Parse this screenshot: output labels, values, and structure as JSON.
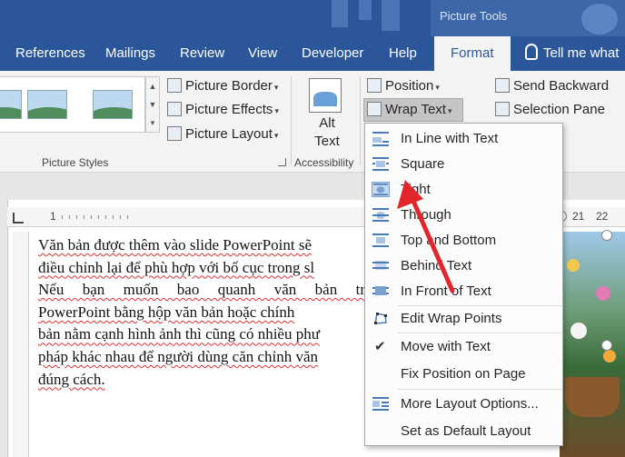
{
  "context_tab": {
    "label": "Picture Tools"
  },
  "tabs": [
    {
      "label": "References"
    },
    {
      "label": "Mailings"
    },
    {
      "label": "Review"
    },
    {
      "label": "View"
    },
    {
      "label": "Developer"
    },
    {
      "label": "Help"
    },
    {
      "label": "Format"
    }
  ],
  "tell_me": {
    "label": "Tell me what"
  },
  "ribbon": {
    "picture_border": "Picture Border",
    "picture_effects": "Picture Effects",
    "picture_layout": "Picture Layout",
    "picture_styles_label": "Picture Styles",
    "alt_text": "Alt Text",
    "accessibility_label": "Accessibility",
    "position": "Position",
    "wrap_text": "Wrap Text",
    "send_backward": "Send Backward",
    "selection_pane": "Selection Pane"
  },
  "ruler": {
    "left_number": "1",
    "right_numbers": [
      "21",
      "22"
    ]
  },
  "document": {
    "lines": [
      "Văn bản được thêm vào slide PowerPoint sẽ",
      "điều chỉnh lại để phù hợp với bố cục trong sl",
      "Nếu bạn muốn bao quanh văn bản tr",
      "PowerPoint bằng hộp văn bản hoặc chính",
      "bản nằm cạnh hình ảnh thì cũng có nhiều phư",
      "pháp khác nhau để người dùng căn chỉnh văn",
      "đúng cách."
    ]
  },
  "wrap_menu": {
    "items": [
      {
        "label": "In Line with Text",
        "icon": "inline-icon"
      },
      {
        "label": "Square",
        "icon": "square-wrap-icon"
      },
      {
        "label": "Tight",
        "icon": "tight-wrap-icon",
        "highlighted": true
      },
      {
        "label": "Through",
        "icon": "through-wrap-icon"
      },
      {
        "label": "Top and Bottom",
        "icon": "top-bottom-wrap-icon"
      },
      {
        "label": "Behind Text",
        "icon": "behind-text-icon"
      },
      {
        "label": "In Front of Text",
        "icon": "in-front-text-icon"
      },
      {
        "label": "Edit Wrap Points",
        "icon": "edit-wrap-points-icon"
      },
      {
        "label": "Move with Text",
        "icon": "checkmark-icon",
        "checked": true
      },
      {
        "label": "Fix Position on Page",
        "icon": ""
      },
      {
        "label": "More Layout Options...",
        "icon": "layout-options-icon"
      },
      {
        "label": "Set as Default Layout",
        "icon": ""
      }
    ]
  },
  "colors": {
    "ribbon_blue": "#2b579a",
    "arrow_red": "#e3262b",
    "highlight": "#c7d9ee"
  }
}
